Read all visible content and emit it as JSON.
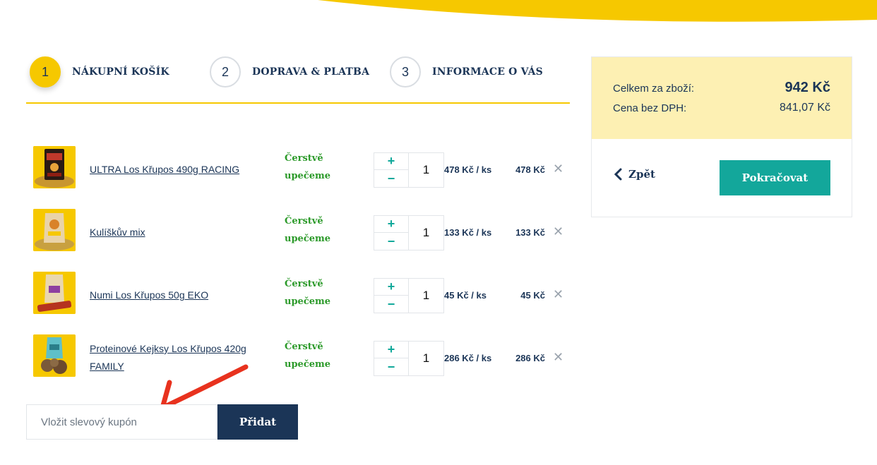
{
  "steps": [
    {
      "number": "1",
      "label": "NÁKUPNÍ KOŠÍK"
    },
    {
      "number": "2",
      "label": "DOPRAVA & PLATBA"
    },
    {
      "number": "3",
      "label": "INFORMACE O VÁS"
    }
  ],
  "cart": {
    "items": [
      {
        "name": "ULTRA Los Křupos 490g RACING",
        "availability": "Čerstvě upečeme",
        "quantity": "1",
        "unit_price": "478 Kč / ks",
        "total": "478 Kč"
      },
      {
        "name": "Kulíškův mix",
        "availability": "Čerstvě upečeme",
        "quantity": "1",
        "unit_price": "133 Kč / ks",
        "total": "133 Kč"
      },
      {
        "name": "Numi Los Křupos 50g EKO",
        "availability": "Čerstvě upečeme",
        "quantity": "1",
        "unit_price": "45 Kč / ks",
        "total": "45 Kč"
      },
      {
        "name": "Proteinové Kejksy Los Křupos 420g FAMILY",
        "availability": "Čerstvě upečeme",
        "quantity": "1",
        "unit_price": "286 Kč / ks",
        "total": "286 Kč"
      }
    ],
    "plus_symbol": "+",
    "minus_symbol": "−",
    "remove_symbol": "✕"
  },
  "coupon": {
    "placeholder": "Vložit slevový kupón",
    "button_label": "Přidat"
  },
  "summary": {
    "goods_total_label": "Celkem za zboží:",
    "goods_total_value": "942 Kč",
    "without_vat_label": "Cena bez DPH:",
    "without_vat_value": "841,07 Kč",
    "back_label": "Zpět",
    "continue_label": "Pokračovat"
  },
  "colors": {
    "brand_yellow": "#f6c800",
    "navy": "#1b3557",
    "teal": "#13a79b",
    "fresh_green": "#2c9a2a",
    "summary_bg": "#fdf0b3",
    "annotation_red": "#e8321e"
  }
}
